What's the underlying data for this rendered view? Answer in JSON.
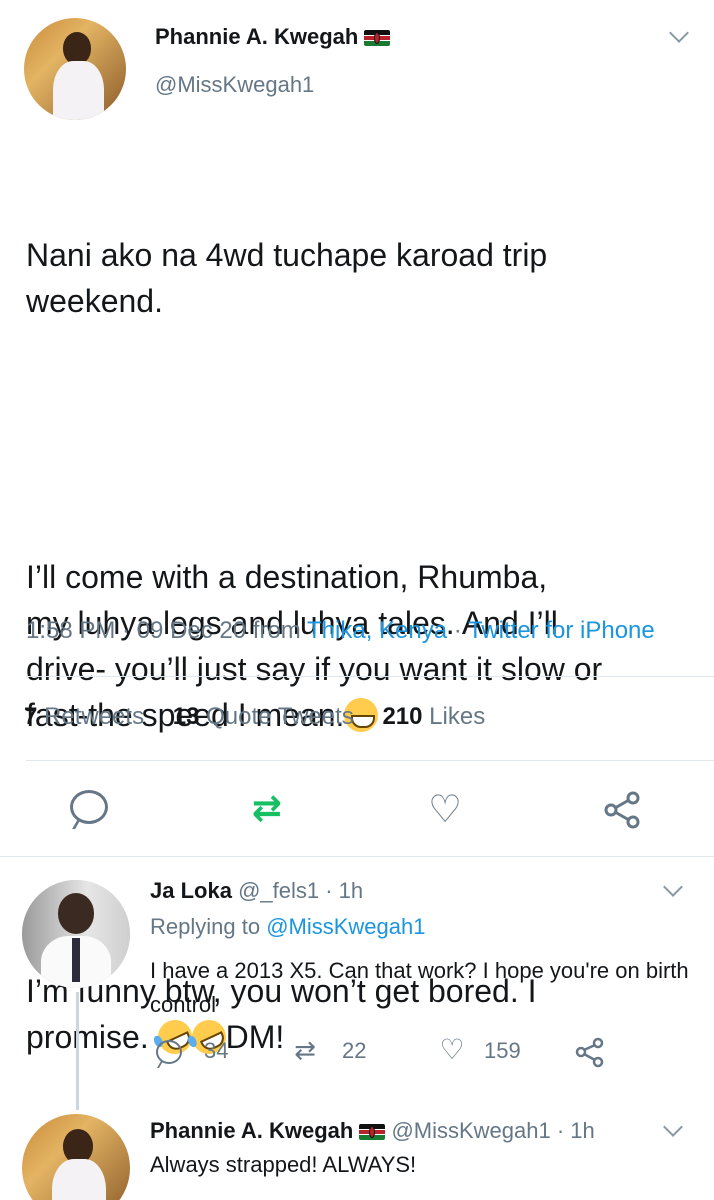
{
  "main_tweet": {
    "author": {
      "display_name": "Phannie A. Kwegah",
      "handle": "@MissKwegah1",
      "flag": "kenya-flag"
    },
    "paragraphs": [
      [
        "Nani ako na 4wd tuchape karoad trip",
        "weekend."
      ],
      [
        "I’ll come with a destination, Rhumba,",
        "my luhya legs and luhya tales. And I’ll",
        "drive- you’ll just say if you want it slow or",
        "fast-the speed I mean."
      ],
      [
        "I’m funny btw, you won’t get bored. I",
        "promise.",
        "DM!"
      ]
    ],
    "emojis": [
      "grinning-face-emoji",
      "rofl-emoji",
      "rofl-emoji"
    ],
    "timestamp": "1:58 PM · 09 Dec 20 from ",
    "location": "Thika, Kenya",
    "source_sep": " · ",
    "source": "Twitter for iPhone",
    "stats": {
      "retweets_count": "7",
      "retweets_label": "Retweets",
      "quotes_count": "13",
      "quotes_label": "Quote Tweets",
      "likes_count": "210",
      "likes_label": "Likes"
    },
    "actions": [
      "reply-icon",
      "retweet-icon",
      "like-icon",
      "share-icon"
    ],
    "retweet_color": "#17bf63"
  },
  "replies": [
    {
      "display_name": "Ja Loka",
      "handle": "@_fels1 · 1h",
      "replying_prefix": "Replying to ",
      "replying_to": "@MissKwegah1",
      "text": "I have a 2013 X5. Can that work? I hope you're on birth control",
      "reply_count": "34",
      "retweet_count": "22",
      "like_count": "159"
    },
    {
      "display_name": "Phannie A. Kwegah",
      "handle": "@MissKwegah1 · 1h",
      "text": "Always strapped! ALWAYS!"
    }
  ],
  "colors": {
    "link": "#1b95e0",
    "secondary": "#657786",
    "primary_text": "#14171a",
    "divider": "#e1e8ed"
  }
}
